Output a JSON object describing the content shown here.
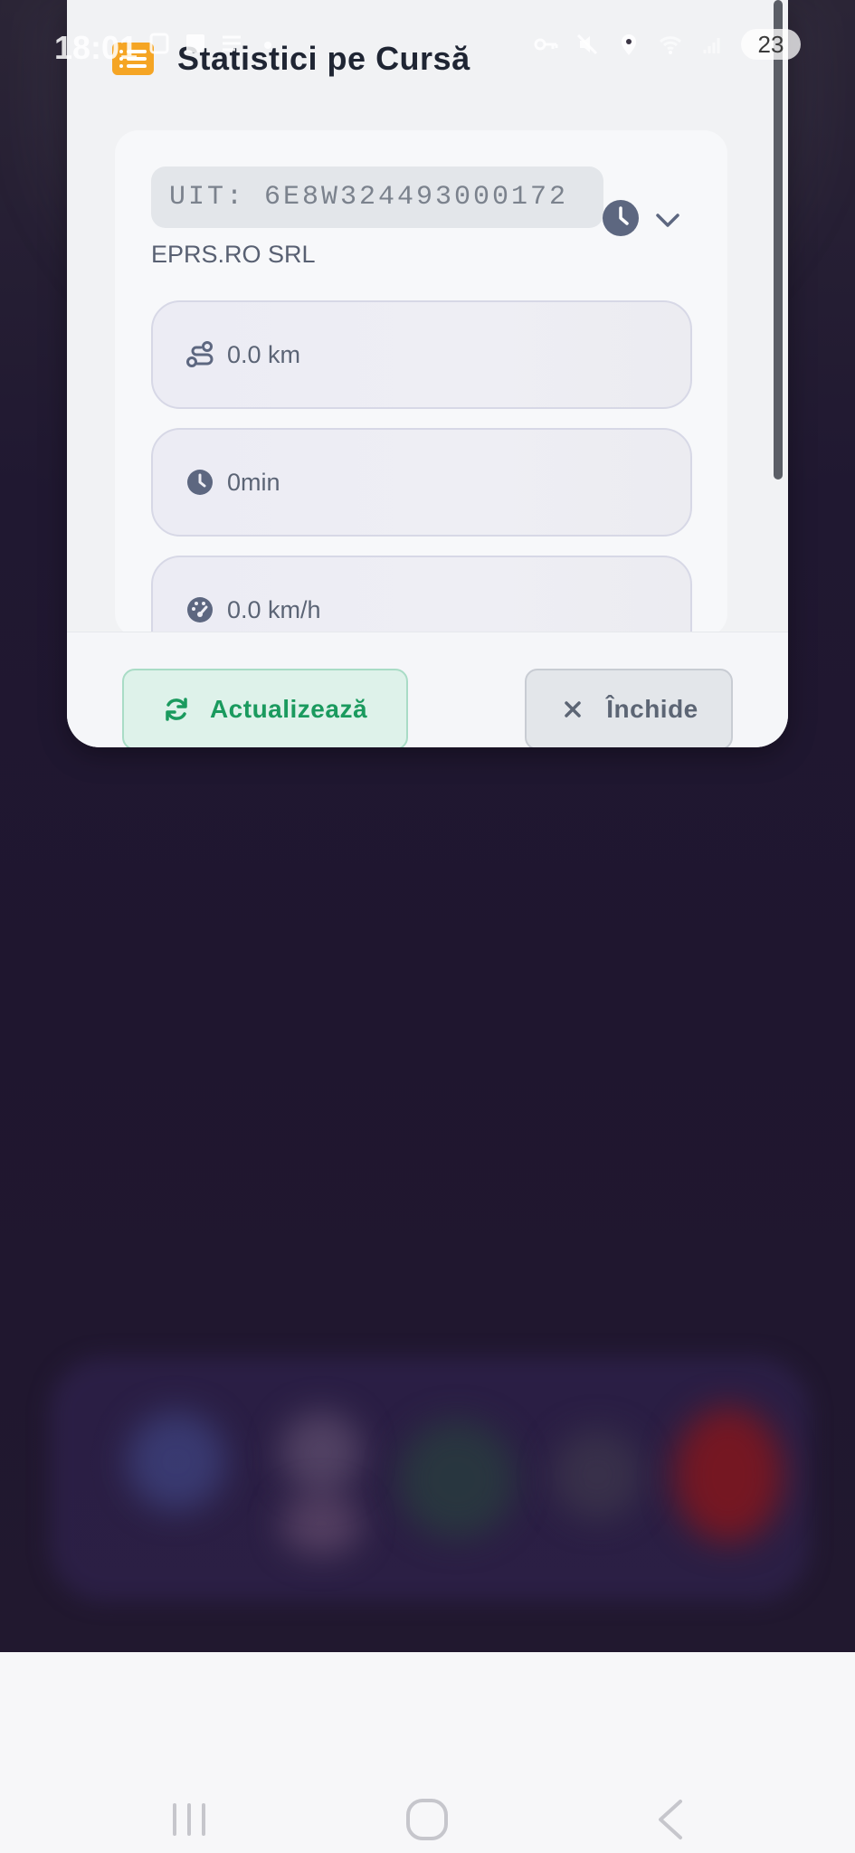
{
  "status_bar": {
    "time": "18:01",
    "battery": "23"
  },
  "dialog": {
    "title": "Statistici pe Cursă",
    "uit": "UIT: 6E8W324493000172",
    "company": "EPRS.RO SRL",
    "stats": {
      "distance": "0.0 km",
      "duration": "0min",
      "speed": "0.0 km/h"
    },
    "buttons": {
      "refresh": "Actualizează",
      "close": "Închide"
    }
  },
  "colors": {
    "accent_orange": "#f5a524",
    "refresh_green": "#1a9a5e",
    "icon_slate": "#5d6780"
  }
}
